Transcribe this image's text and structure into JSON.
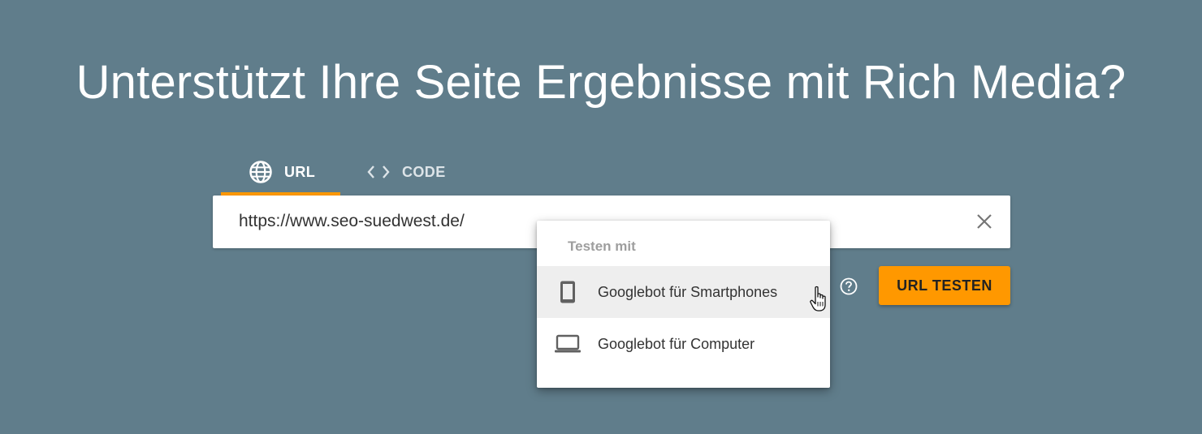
{
  "title": "Unterstützt Ihre Seite Ergebnisse mit Rich Media?",
  "tabs": [
    {
      "label": "URL",
      "icon": "globe-icon",
      "active": true
    },
    {
      "label": "CODE",
      "icon": "code-icon",
      "active": false
    }
  ],
  "url_input": {
    "value": "https://www.seo-suedwest.de/"
  },
  "dropdown": {
    "header": "Testen mit",
    "items": [
      {
        "label": "Googlebot für Smartphones",
        "icon": "smartphone-icon",
        "hovered": true
      },
      {
        "label": "Googlebot für Computer",
        "icon": "laptop-icon",
        "hovered": false
      }
    ]
  },
  "test_button": {
    "label": "URL TESTEN"
  },
  "colors": {
    "background": "#607d8b",
    "accent": "#ff9800",
    "hover": "#eeeeee"
  }
}
